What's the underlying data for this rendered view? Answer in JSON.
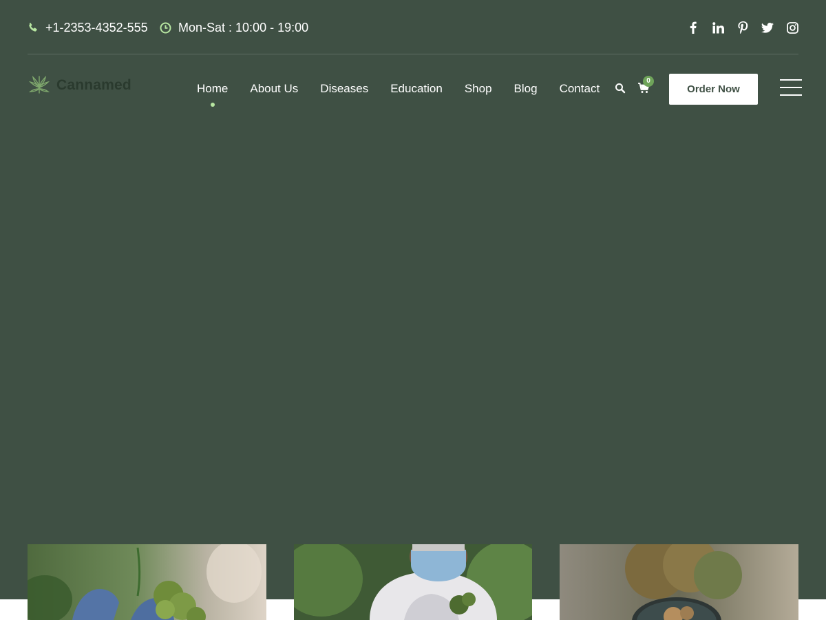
{
  "topbar": {
    "phone": "+1-2353-4352-555",
    "hours": "Mon-Sat : 10:00 - 19:00",
    "socials": [
      "facebook-icon",
      "linkedin-icon",
      "pinterest-icon",
      "twitter-icon",
      "instagram-icon"
    ]
  },
  "header": {
    "brand": "Cannamed",
    "nav": [
      {
        "label": "Home",
        "active": true
      },
      {
        "label": "About Us"
      },
      {
        "label": "Diseases"
      },
      {
        "label": "Education"
      },
      {
        "label": "Shop"
      },
      {
        "label": "Blog"
      },
      {
        "label": "Contact"
      }
    ],
    "cart_count": "0",
    "order_button": "Order Now"
  },
  "cards": [
    {
      "image": "gloved-hand-holding-cannabis-bud"
    },
    {
      "image": "scientist-in-mask-examining-plant"
    },
    {
      "image": "jar-of-dried-cannabis-buds"
    }
  ],
  "colors": {
    "background": "#3f5044",
    "accent": "#6fa45a",
    "active_dot": "#b7e6a1",
    "logo_text": "#2a3a2e",
    "button_bg": "#ffffff",
    "button_text": "#3f5044"
  }
}
